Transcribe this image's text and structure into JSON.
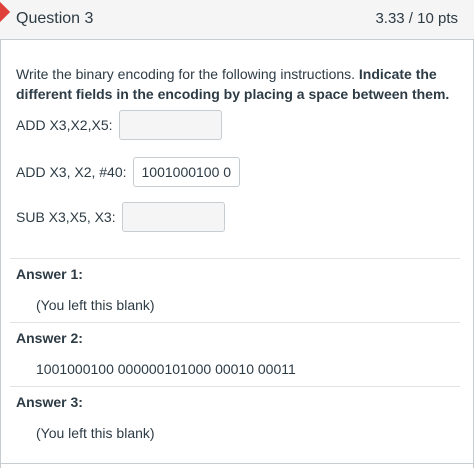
{
  "question": {
    "title": "Question 3",
    "points": "3.33 / 10 pts",
    "prompt_plain": "Write the binary encoding for the following instructions. ",
    "prompt_bold": "Indicate the different fields in the encoding by placing a space between them."
  },
  "blanks": [
    {
      "label": "ADD X3,X2,X5:",
      "value": ""
    },
    {
      "label": "ADD X3, X2, #40:",
      "value": "1001000100 0"
    },
    {
      "label": "SUB X3,X5, X3:",
      "value": ""
    }
  ],
  "answers": [
    {
      "heading": "Answer 1:",
      "value": "(You left this blank)"
    },
    {
      "heading": "Answer 2:",
      "value": "1001000100 000000101000 00010 00011"
    },
    {
      "heading": "Answer 3:",
      "value": "(You left this blank)"
    }
  ],
  "colors": {
    "flag": "#e0403a",
    "header_bg": "#f5f5f5",
    "border": "#c7cdd1",
    "text": "#2d3b45"
  }
}
